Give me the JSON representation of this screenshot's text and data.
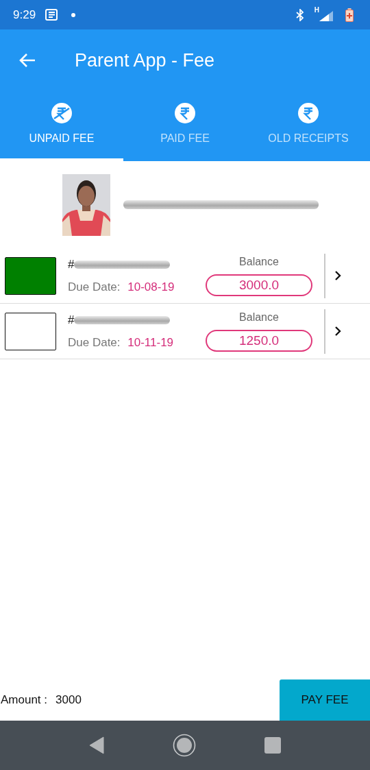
{
  "status_bar": {
    "time": "9:29",
    "network": "H"
  },
  "app_bar": {
    "title": "Parent App - Fee"
  },
  "tabs": [
    {
      "label": "UNPAID FEE",
      "selected": true
    },
    {
      "label": "PAID FEE",
      "selected": false
    },
    {
      "label": "OLD RECEIPTS",
      "selected": false
    }
  ],
  "fees": [
    {
      "color": "#008000",
      "number_prefix": "#",
      "due_label": "Due Date:",
      "due_date": "10-08-19",
      "balance_label": "Balance",
      "balance": "3000.0"
    },
    {
      "color": "#ffffff",
      "number_prefix": "#",
      "due_label": "Due Date:",
      "due_date": "10-11-19",
      "balance_label": "Balance",
      "balance": "1250.0"
    }
  ],
  "footer": {
    "amount_label": "Amount :",
    "amount": "3000",
    "button": "PAY FEE"
  }
}
